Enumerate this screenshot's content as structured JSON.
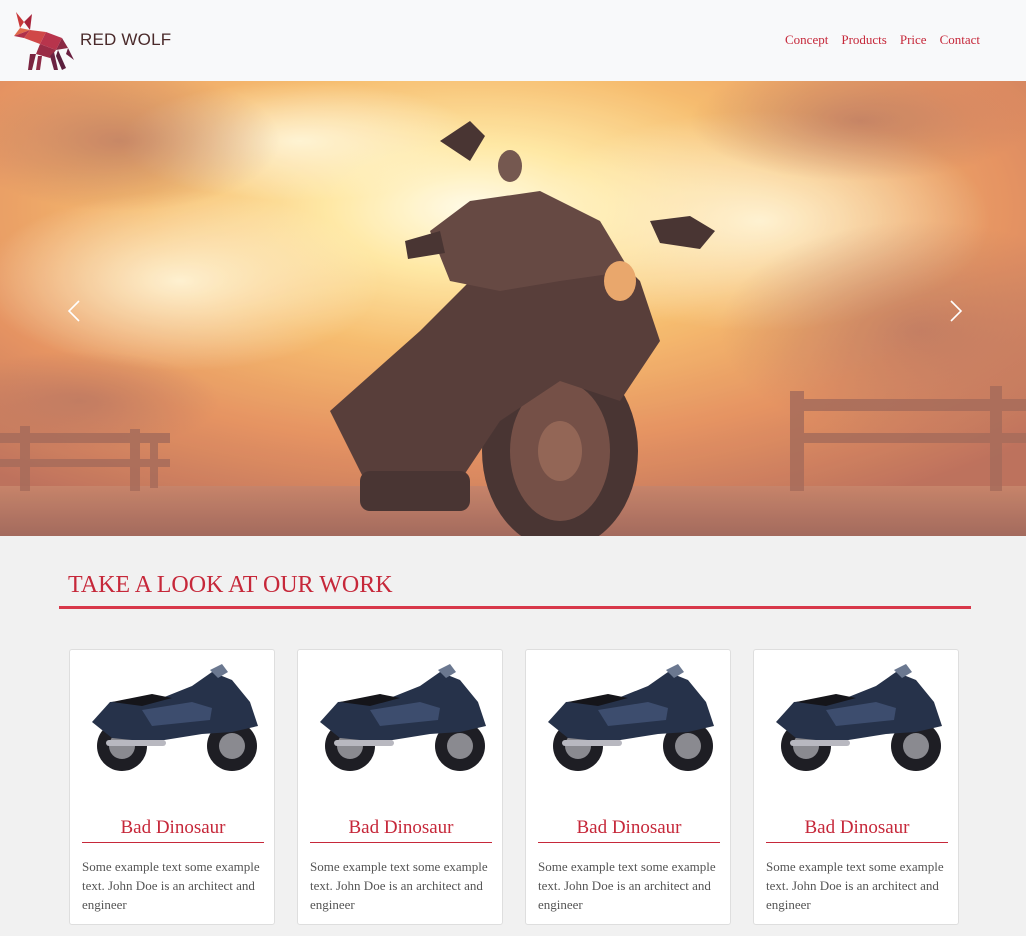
{
  "header": {
    "brand": "RED WOLF",
    "nav": [
      "Concept",
      "Products",
      "Price",
      "Contact"
    ]
  },
  "colors": {
    "accent": "#c6283a",
    "navbar_bg": "#f8f9fa",
    "page_bg": "#f1f1f1"
  },
  "icons": {
    "logo": "red-wolf-logo-icon",
    "prev": "chevron-left-icon",
    "next": "chevron-right-icon"
  },
  "section": {
    "title": "TAKE A LOOK AT OUR WORK"
  },
  "cards": [
    {
      "title": "Bad Dinosaur",
      "text": "Some example text some example text. John Doe is an architect and engineer"
    },
    {
      "title": "Bad Dinosaur",
      "text": "Some example text some example text. John Doe is an architect and engineer"
    },
    {
      "title": "Bad Dinosaur",
      "text": "Some example text some example text. John Doe is an architect and engineer"
    },
    {
      "title": "Bad Dinosaur",
      "text": "Some example text some example text. John Doe is an architect and engineer"
    }
  ]
}
